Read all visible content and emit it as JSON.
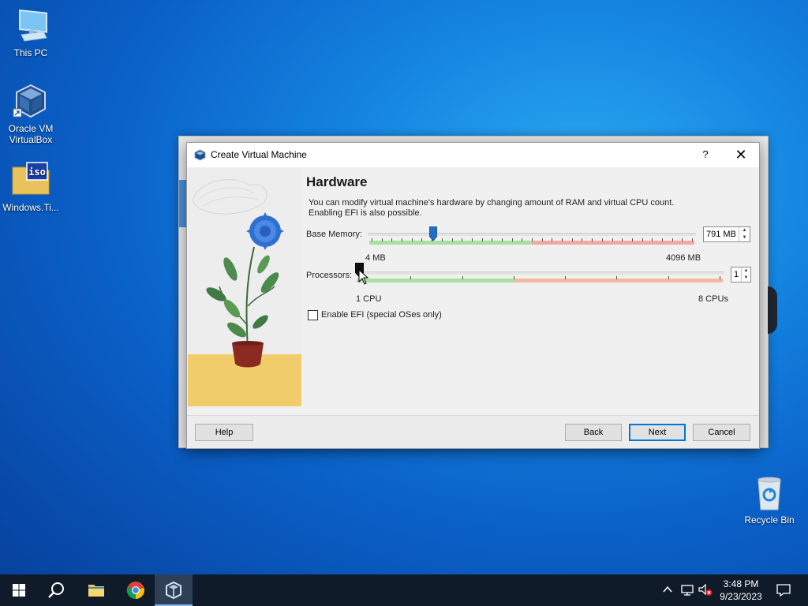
{
  "desktop": {
    "icons": [
      {
        "label": "This PC"
      },
      {
        "label_line1": "Oracle VM",
        "label_line2": "VirtualBox"
      },
      {
        "label": "Windows.Ti..."
      },
      {
        "label": "Recycle Bin"
      }
    ],
    "iso_text": "iso"
  },
  "dialog": {
    "title": "Create Virtual Machine",
    "help_glyph": "?",
    "close_glyph": "✕",
    "page_title": "Hardware",
    "description_line1": "You can modify virtual machine's hardware by changing amount of RAM and virtual CPU count.",
    "description_line2": "Enabling EFI is also possible.",
    "memory": {
      "label": "Base Memory:",
      "value": 791,
      "value_text": "791 MB",
      "min_label": "4 MB",
      "max_label": "4096 MB",
      "min": 4,
      "max": 4096
    },
    "processors": {
      "label": "Processors:",
      "value": 1,
      "value_text": "1",
      "min_label": "1 CPU",
      "max_label": "8 CPUs",
      "min": 1,
      "max": 8
    },
    "efi": {
      "label": "Enable EFI (special OSes only)",
      "checked": false
    },
    "buttons": {
      "help": "Help",
      "back": "Back",
      "next": "Next",
      "cancel": "Cancel"
    }
  },
  "taskbar": {
    "apps": [
      "start-icon",
      "search-icon",
      "file-explorer-icon",
      "chrome-icon",
      "virtualbox-icon"
    ],
    "active_app": "virtualbox-icon",
    "clock_time": "3:48 PM",
    "clock_date": "9/23/2023"
  },
  "colors": {
    "accent": "#0078d7",
    "memory_handle": "#1f6fc4",
    "green_band": "#a8e0a0",
    "red_band": "#f0a8a0"
  }
}
